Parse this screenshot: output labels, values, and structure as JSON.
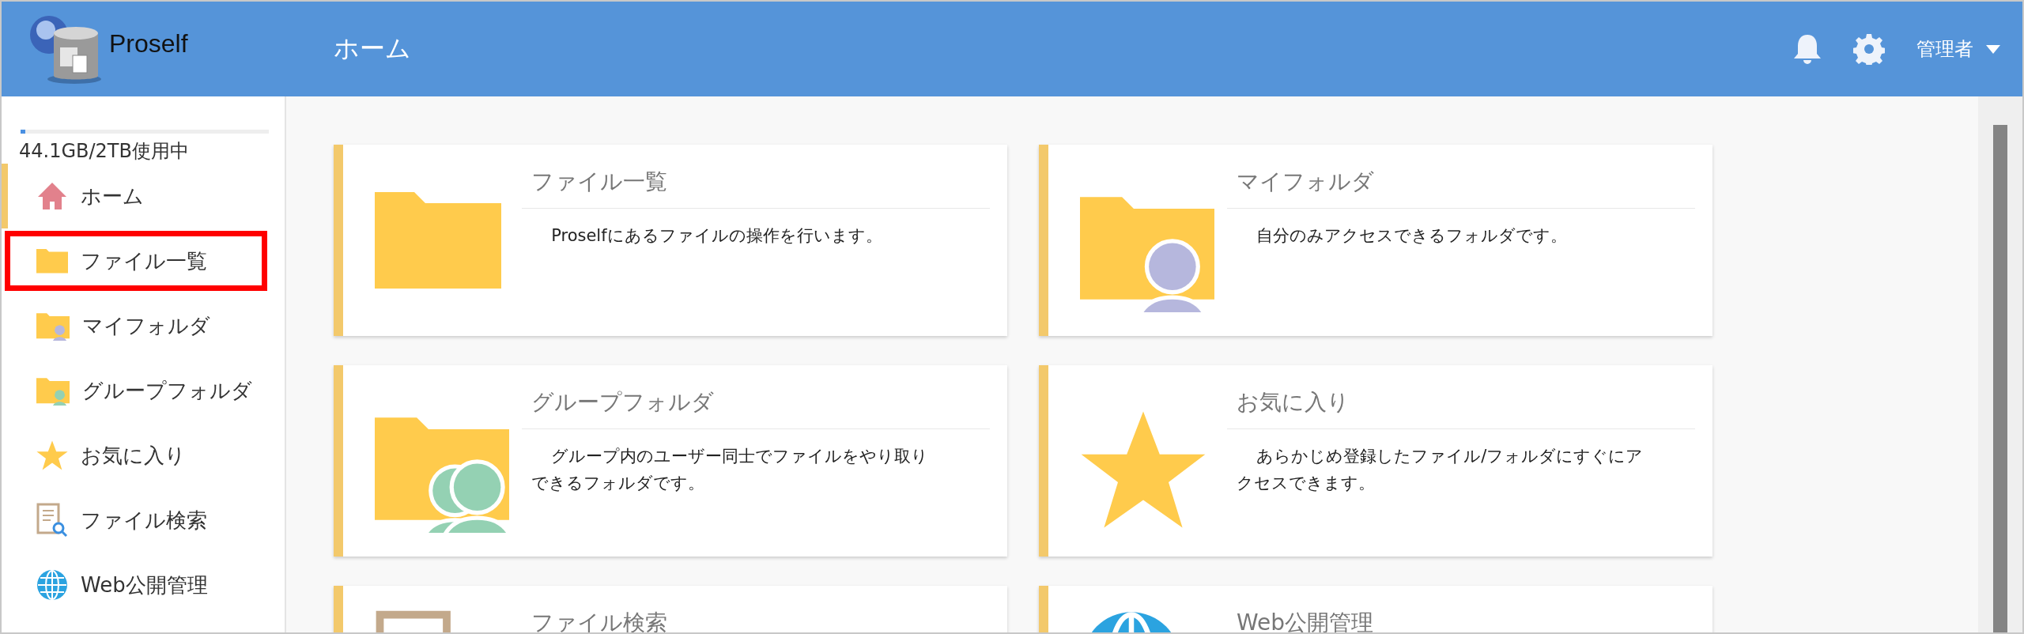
{
  "header": {
    "app_name": "Proself",
    "page_title": "ホーム",
    "user_menu": "管理者"
  },
  "sidebar": {
    "storage": {
      "level": 0.02,
      "label": "44.1GB/2TB使用中"
    },
    "items": [
      {
        "kind": "home",
        "label": "ホーム",
        "selected": true,
        "highlighted": false
      },
      {
        "kind": "files",
        "label": "ファイル一覧",
        "selected": false,
        "highlighted": true
      },
      {
        "kind": "myfolder",
        "label": "マイフォルダ",
        "selected": false,
        "highlighted": false
      },
      {
        "kind": "groupfolder",
        "label": "グループフォルダ",
        "selected": false,
        "highlighted": false
      },
      {
        "kind": "favorites",
        "label": "お気に入り",
        "selected": false,
        "highlighted": false
      },
      {
        "kind": "search",
        "label": "ファイル検索",
        "selected": false,
        "highlighted": false
      },
      {
        "kind": "web",
        "label": "Web公開管理",
        "selected": false,
        "highlighted": false
      }
    ]
  },
  "cards": [
    {
      "kind": "files",
      "title": "ファイル一覧",
      "description": "Proselfにあるファイルの操作を行います。"
    },
    {
      "kind": "myfolder",
      "title": "マイフォルダ",
      "description": "自分のみアクセスできるフォルダです。"
    },
    {
      "kind": "groupfolder",
      "title": "グループフォルダ",
      "description": "グループ内のユーザー同士でファイルをやり取りできるフォルダです。"
    },
    {
      "kind": "favorites",
      "title": "お気に入り",
      "description": "あらかじめ登録したファイル/フォルダにすぐにアクセスできます。"
    },
    {
      "kind": "search",
      "title": "ファイル検索"
    },
    {
      "kind": "web",
      "title": "Web公開管理"
    }
  ]
}
